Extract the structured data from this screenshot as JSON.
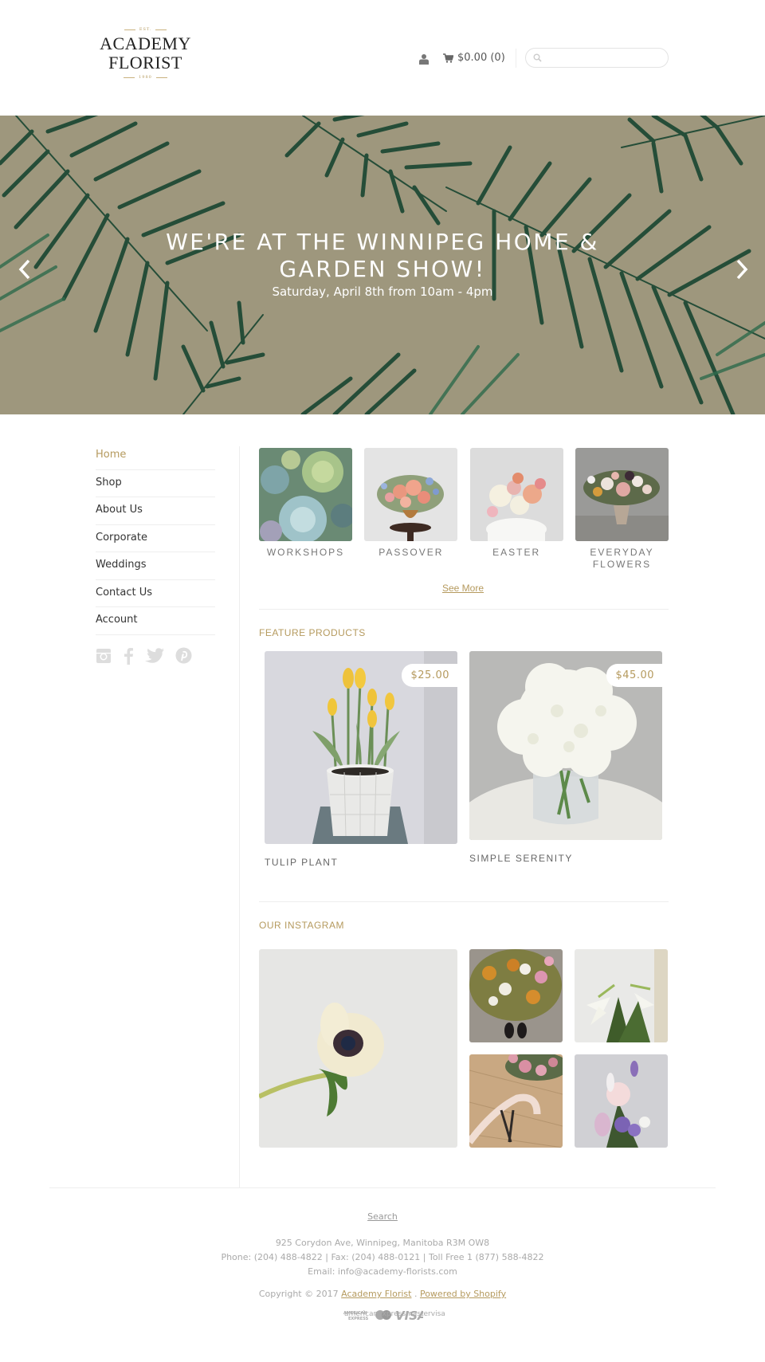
{
  "header": {
    "logo": {
      "est": "EST.",
      "line1": "ACADEMY",
      "line2": "FLORIST",
      "year": "1980"
    },
    "cart_label": "$0.00 (0)",
    "search_placeholder": ""
  },
  "hero": {
    "title": "WE'RE AT THE WINNIPEG HOME & GARDEN SHOW!",
    "subtitle": "Saturday, April 8th from 10am - 4pm",
    "prev_icon": "chevron-left-icon",
    "next_icon": "chevron-right-icon",
    "bg_color": "#9e977d"
  },
  "sidebar": {
    "items": [
      {
        "label": "Home",
        "active": true
      },
      {
        "label": "Shop"
      },
      {
        "label": "About Us"
      },
      {
        "label": "Corporate"
      },
      {
        "label": "Weddings"
      },
      {
        "label": "Contact Us"
      },
      {
        "label": "Account"
      }
    ],
    "socials": [
      "instagram-icon",
      "facebook-icon",
      "twitter-icon",
      "pinterest-icon"
    ]
  },
  "collections": {
    "items": [
      {
        "label": "WORKSHOPS"
      },
      {
        "label": "PASSOVER"
      },
      {
        "label": "EASTER"
      },
      {
        "label": "EVERYDAY FLOWERS"
      }
    ],
    "see_more": "See More"
  },
  "featured": {
    "title": "FEATURE PRODUCTS",
    "products": [
      {
        "name": "TULIP PLANT",
        "price": "$25.00"
      },
      {
        "name": "SIMPLE SERENITY",
        "price": "$45.00"
      }
    ]
  },
  "instagram": {
    "title": "OUR INSTAGRAM"
  },
  "footer": {
    "search": "Search",
    "address": "925 Corydon Ave, Winnipeg, Manitoba R3M OW8",
    "phone": "Phone: (204) 488-4822 | Fax: (204) 488-0121 | Toll Free 1 (877) 588-4822",
    "email": "Email: info@academy-florists.com",
    "copyright_prefix": "Copyright © 2017",
    "brand_link": "Academy Florist",
    "separator": ".",
    "powered_link": "Powered by Shopify",
    "payment_text": "americanexpressmastervisa"
  },
  "colors": {
    "accent": "#b59a5e",
    "text": "#333333",
    "muted": "#aaaaaa",
    "border": "#eeeeee"
  }
}
